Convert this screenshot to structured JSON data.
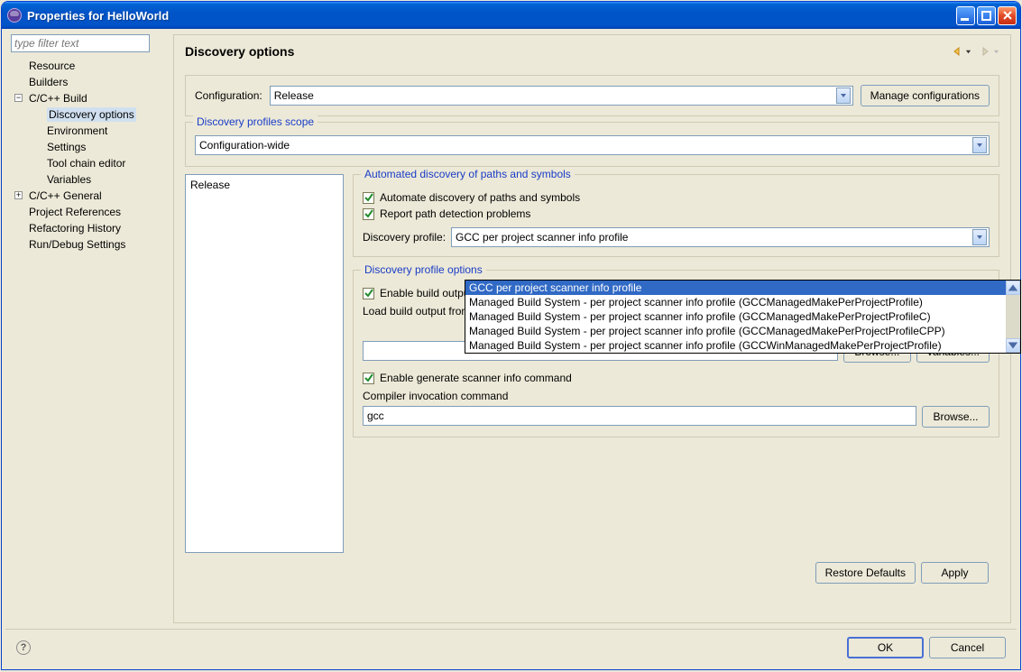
{
  "window": {
    "title": "Properties for HelloWorld"
  },
  "filter": {
    "placeholder": "type filter text"
  },
  "tree": {
    "items": [
      {
        "label": "Resource"
      },
      {
        "label": "Builders"
      },
      {
        "label": "C/C++ Build",
        "expanded": true,
        "children": [
          {
            "label": "Discovery options",
            "selected": true
          },
          {
            "label": "Environment"
          },
          {
            "label": "Settings"
          },
          {
            "label": "Tool chain editor"
          },
          {
            "label": "Variables"
          }
        ]
      },
      {
        "label": "C/C++ General",
        "expandable": true
      },
      {
        "label": "Project References"
      },
      {
        "label": "Refactoring History"
      },
      {
        "label": "Run/Debug Settings"
      }
    ]
  },
  "page": {
    "title": "Discovery options",
    "configuration_label": "Configuration:",
    "configuration_value": "Release",
    "manage_configs": "Manage configurations",
    "scope_group": "Discovery profiles scope",
    "scope_value": "Configuration-wide",
    "list": {
      "items": [
        "Release"
      ]
    },
    "auto_group": "Automated discovery of paths and symbols",
    "chk_automate": "Automate discovery of paths and symbols",
    "chk_report": "Report path detection problems",
    "profile_label": "Discovery profile:",
    "profile_value": "GCC per project scanner info profile",
    "profile_options_group": "Discovery profile options",
    "chk_enable_build_output": "Enable build output scanner info discovery",
    "load_build_output": "Load build output from file",
    "load_path": "",
    "browse": "Browse...",
    "variables": "Variables...",
    "chk_enable_generate": "Enable generate scanner info command",
    "compiler_cmd_label": "Compiler invocation command",
    "compiler_cmd_value": "gcc",
    "restore_defaults": "Restore Defaults",
    "apply": "Apply"
  },
  "dropdown": {
    "items": [
      "GCC per project scanner info profile",
      "Managed Build System - per project scanner info profile (GCCManagedMakePerProjectProfile)",
      "Managed Build System - per project scanner info profile (GCCManagedMakePerProjectProfileC)",
      "Managed Build System - per project scanner info profile (GCCManagedMakePerProjectProfileCPP)",
      "Managed Build System - per project scanner info profile (GCCWinManagedMakePerProjectProfile)"
    ],
    "selected_index": 0
  },
  "footer": {
    "ok": "OK",
    "cancel": "Cancel"
  }
}
